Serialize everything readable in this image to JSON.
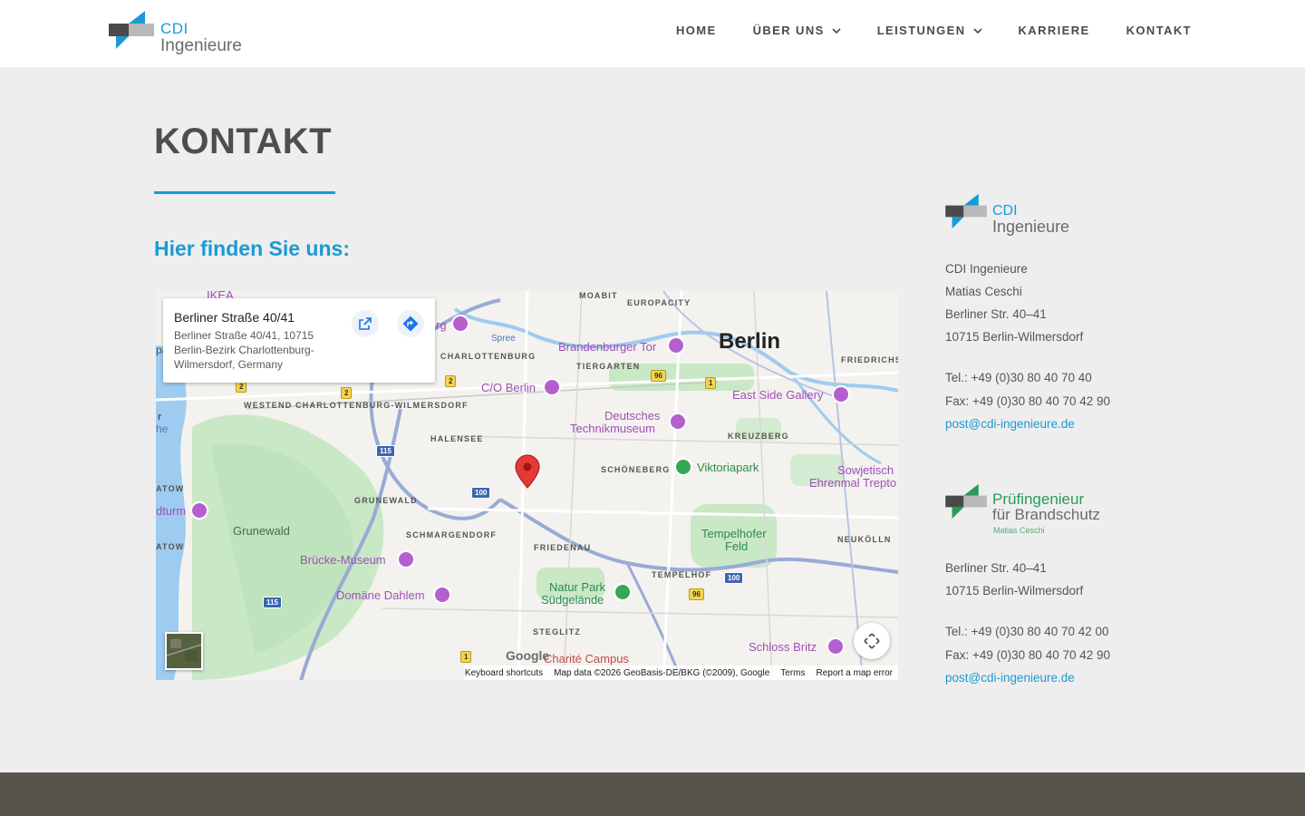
{
  "header": {
    "logo": {
      "line1": "CDI",
      "line2": "Ingenieure"
    },
    "nav": [
      {
        "label": "HOME",
        "dropdown": false
      },
      {
        "label": "ÜBER UNS",
        "dropdown": true
      },
      {
        "label": "LEISTUNGEN",
        "dropdown": true
      },
      {
        "label": "KARRIERE",
        "dropdown": false
      },
      {
        "label": "KONTAKT",
        "dropdown": false
      }
    ]
  },
  "main": {
    "title": "KONTAKT",
    "subtitle": "Hier finden Sie uns:"
  },
  "map": {
    "card": {
      "title": "Berliner Straße 40/41",
      "address": "Berliner Straße 40/41, 10715 Berlin-Bezirk Charlottenburg-Wilmersdorf, Germany"
    },
    "labels": {
      "berlin": "Berlin",
      "moabit": "MOABIT",
      "europacity": "EUROPACITY",
      "spree": "Spree",
      "charlottenburg": "CHARLOTTENBURG",
      "brandenburger": "Brandenburger Tor",
      "tiergarten": "TIERGARTEN",
      "friedrichs": "FRIEDRICHSH",
      "westend": "WESTEND CHARLOTTENBURG-WILMERSDORF",
      "co_berlin": "C/O Berlin",
      "eastside": "East Side Gallery",
      "technik1": "Deutsches",
      "technik2": "Technikmuseum",
      "halensee": "HALENSEE",
      "kreuzberg": "KREUZBERG",
      "schoeneberg": "SCHÖNEBERG",
      "viktoriapark": "Viktoriapark",
      "sowjet1": "Sowjetisch",
      "sowjet2": "Ehrenmal Trepto",
      "grunewald_d": "GRUNEWALD",
      "grunewald": "Grunewald",
      "schmargendorf": "SCHMARGENDORF",
      "tempelhoferfeld1": "Tempelhofer",
      "tempelhoferfeld2": "Feld",
      "neukoelln": "NEUKÖLLN",
      "bruecke": "Brücke-Museum",
      "friedenau": "FRIEDENAU",
      "tempelhof": "TEMPELHOF",
      "naturpark1": "Natur Park",
      "naturpark2": "Südgelände",
      "domaene": "Domäne Dahlem",
      "steglitz": "STEGLITZ",
      "schlossbritz": "Schloss Britz",
      "charite": "Charité Campus",
      "ikea": "IKEA",
      "rg": "rg",
      "turm": "dturm",
      "tow1": "ATOW",
      "tow2": "ATOW",
      "r": "r",
      "he": "he",
      "pa": "pa"
    },
    "shields": {
      "a100a": "100",
      "a100b": "100",
      "a115a": "115",
      "a115b": "115",
      "b96a": "96",
      "b96b": "96",
      "b1a": "1",
      "b1b": "1",
      "b2a": "2",
      "b2b": "2",
      "b2c": "2"
    },
    "google": "Google",
    "attribution": {
      "shortcuts": "Keyboard shortcuts",
      "mapdata": "Map data ©2026 GeoBasis-DE/BKG (©2009), Google",
      "terms": "Terms",
      "report": "Report a map error"
    }
  },
  "sidebar": {
    "logo": {
      "line1": "CDI",
      "line2": "Ingenieure"
    },
    "cdi": {
      "name": "CDI Ingenieure",
      "person": "Matias Ceschi",
      "street": "Berliner Str. 40–41",
      "city": "10715 Berlin-Wilmersdorf",
      "tel": "Tel.: +49 (0)30 80 40 70 40",
      "fax": "Fax: +49 (0)30 80 40 70 42 90",
      "email": "post@cdi-ingenieure.de"
    },
    "brand_logo": {
      "line1": "Prüfingenieur",
      "line2": "für Brandschutz",
      "line3": "Matias Ceschi"
    },
    "brand": {
      "street": "Berliner Str. 40–41",
      "city": "10715 Berlin-Wilmersdorf",
      "tel": "Tel.: +49 (0)30 80 40 70 42 00",
      "fax": "Fax: +49 (0)30 80 40 70 42 90",
      "email": "post@cdi-ingenieure.de"
    }
  },
  "colors": {
    "accent": "#1a9ad6",
    "brand_green": "#2b9a5a",
    "footer": "#57544e",
    "background": "#eeeeee"
  }
}
